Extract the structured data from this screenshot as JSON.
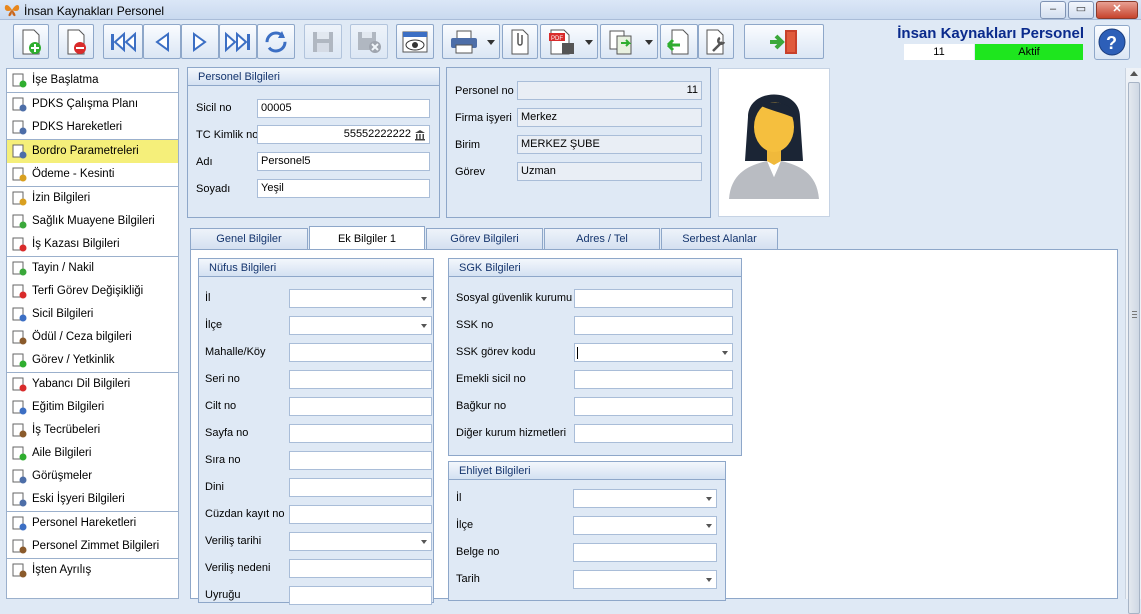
{
  "window": {
    "title": "İnsan Kaynakları Personel"
  },
  "header": {
    "app_title": "İnsan Kaynakları Personel",
    "status_number": "11",
    "status_label": "Aktif"
  },
  "sidebar": {
    "groups": [
      [
        "İşe Başlatma"
      ],
      [
        "PDKS Çalışma Planı",
        "PDKS Hareketleri"
      ],
      [
        "Bordro Parametreleri",
        "Ödeme - Kesinti"
      ],
      [
        "İzin Bilgileri",
        "Sağlık Muayene Bilgileri",
        "İş Kazası Bilgileri"
      ],
      [
        "Tayin / Nakil",
        "Terfi Görev Değişikliği",
        "Sicil Bilgileri",
        "Ödül / Ceza bilgileri",
        "Görev / Yetkinlik"
      ],
      [
        "Yabancı Dil Bilgileri",
        "Eğitim Bilgileri",
        "İş Tecrübeleri",
        "Aile Bilgileri",
        "Görüşmeler",
        "Eski İşyeri Bilgileri"
      ],
      [
        "Personel Hareketleri",
        "Personel Zimmet Bilgileri"
      ],
      [
        "İşten Ayrılış"
      ]
    ],
    "active": "Bordro Parametreleri"
  },
  "personel": {
    "title": "Personel Bilgileri",
    "sicil_label": "Sicil no",
    "sicil_value": "00005",
    "tc_label": "TC Kimlik no",
    "tc_value": "55552222222",
    "adi_label": "Adı",
    "adi_value": "Personel5",
    "soyadi_label": "Soyadı",
    "soyadi_value": "Yeşil"
  },
  "info": {
    "pno_label": "Personel no",
    "pno_value": "11",
    "firma_label": "Firma işyeri",
    "firma_value": "Merkez",
    "birim_label": "Birim",
    "birim_value": "MERKEZ ŞUBE",
    "gorev_label": "Görev",
    "gorev_value": "Uzman"
  },
  "tabs": [
    "Genel Bilgiler",
    "Ek Bilgiler 1",
    "Görev Bilgileri",
    "Adres / Tel",
    "Serbest Alanlar"
  ],
  "nufus": {
    "title": "Nüfus Bilgileri",
    "fields": [
      "İl",
      "İlçe",
      "Mahalle/Köy",
      "Seri no",
      "Cilt no",
      "Sayfa no",
      "Sıra no",
      "Dini",
      "Cüzdan kayıt no",
      "Veriliş tarihi",
      "Veriliş nedeni",
      "Uyruğu"
    ]
  },
  "sgk": {
    "title": "SGK Bilgileri",
    "fields": [
      "Sosyal güvenlik kurumu",
      "SSK no",
      "SSK görev kodu",
      "Emekli sicil no",
      "Bağkur no",
      "Diğer kurum hizmetleri"
    ]
  },
  "ehliyet": {
    "title": "Ehliyet Bilgileri",
    "fields": [
      "İl",
      "İlçe",
      "Belge no",
      "Tarih"
    ]
  },
  "colors": {
    "title_blue": "#0a2a8c",
    "status_green": "#1ee61e",
    "active_item": "#f5ef7a"
  }
}
